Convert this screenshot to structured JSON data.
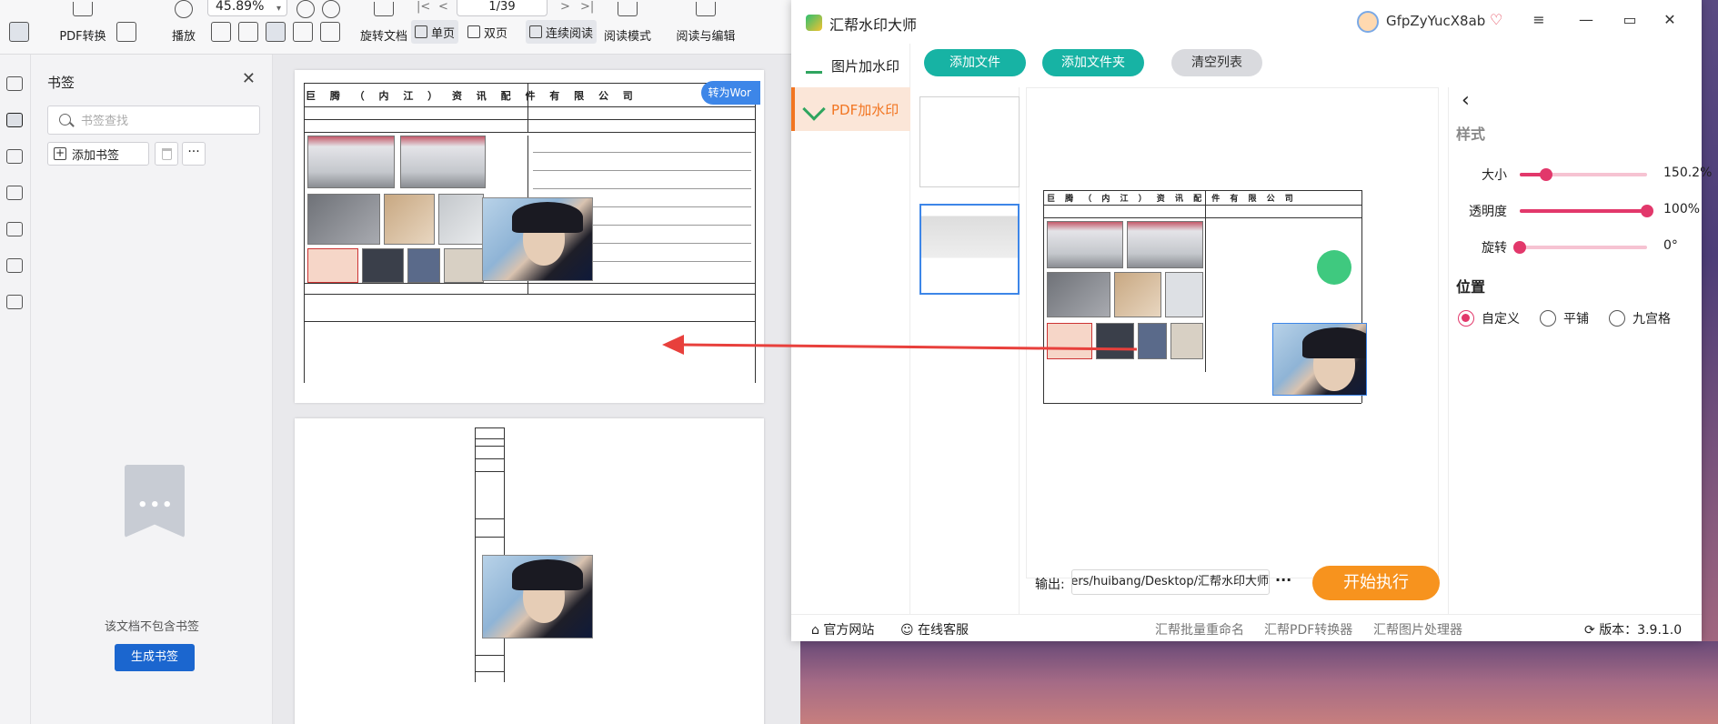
{
  "reader": {
    "toolbar": {
      "pdf_convert": "PDF转换",
      "play": "播放",
      "zoom": "45.89%",
      "page_indicator": "1/39",
      "rotate_doc": "旋转文档",
      "single_page": "单页",
      "double_page": "双页",
      "continuous": "连续阅读",
      "read_mode": "阅读模式",
      "read_edit": "阅读与编辑"
    },
    "bookmarks": {
      "title": "书签",
      "search_placeholder": "书签查找",
      "add_label": "添加书签",
      "more": "···",
      "empty_text": "该文档不包含书签",
      "generate_label": "生成书签"
    },
    "document": {
      "to_word": "转为Wor",
      "title": "巨 腾 （ 内 江 ） 资 讯 配 件 有 限 公 司"
    }
  },
  "wm": {
    "title": "汇帮水印大师",
    "user": "GfpZyYucX8ab",
    "nav": [
      {
        "label": "图片加水印"
      },
      {
        "label": "PDF加水印"
      }
    ],
    "buttons": {
      "add_file": "添加文件",
      "add_folder": "添加文件夹",
      "clear_list": "清空列表",
      "start": "开始执行"
    },
    "output": {
      "label": "输出:",
      "path": "C:/Users/huibang/Desktop/汇帮水印大师",
      "more": "···"
    },
    "settings": {
      "style_head": "样式",
      "size_label": "大小",
      "size_value": "150.2%",
      "size_level": 0.21,
      "opacity_label": "透明度",
      "opacity_value": "100%",
      "opacity_level": 1.0,
      "rotate_label": "旋转",
      "rotate_value": "0°",
      "rotate_level": 0.0,
      "position_head": "位置",
      "pos_custom": "自定义",
      "pos_tile": "平铺",
      "pos_nine": "九宫格"
    },
    "footer": {
      "website": "官方网站",
      "support": "在线客服",
      "batch_rename": "汇帮批量重命名",
      "pdf_converter": "汇帮PDF转换器",
      "image_processor": "汇帮图片处理器",
      "version": "版本：3.9.1.0"
    },
    "colors": {
      "accent_orange": "#f27521",
      "teal": "#17b3a4",
      "slider": "#e2386b",
      "start": "#f7931e"
    }
  }
}
